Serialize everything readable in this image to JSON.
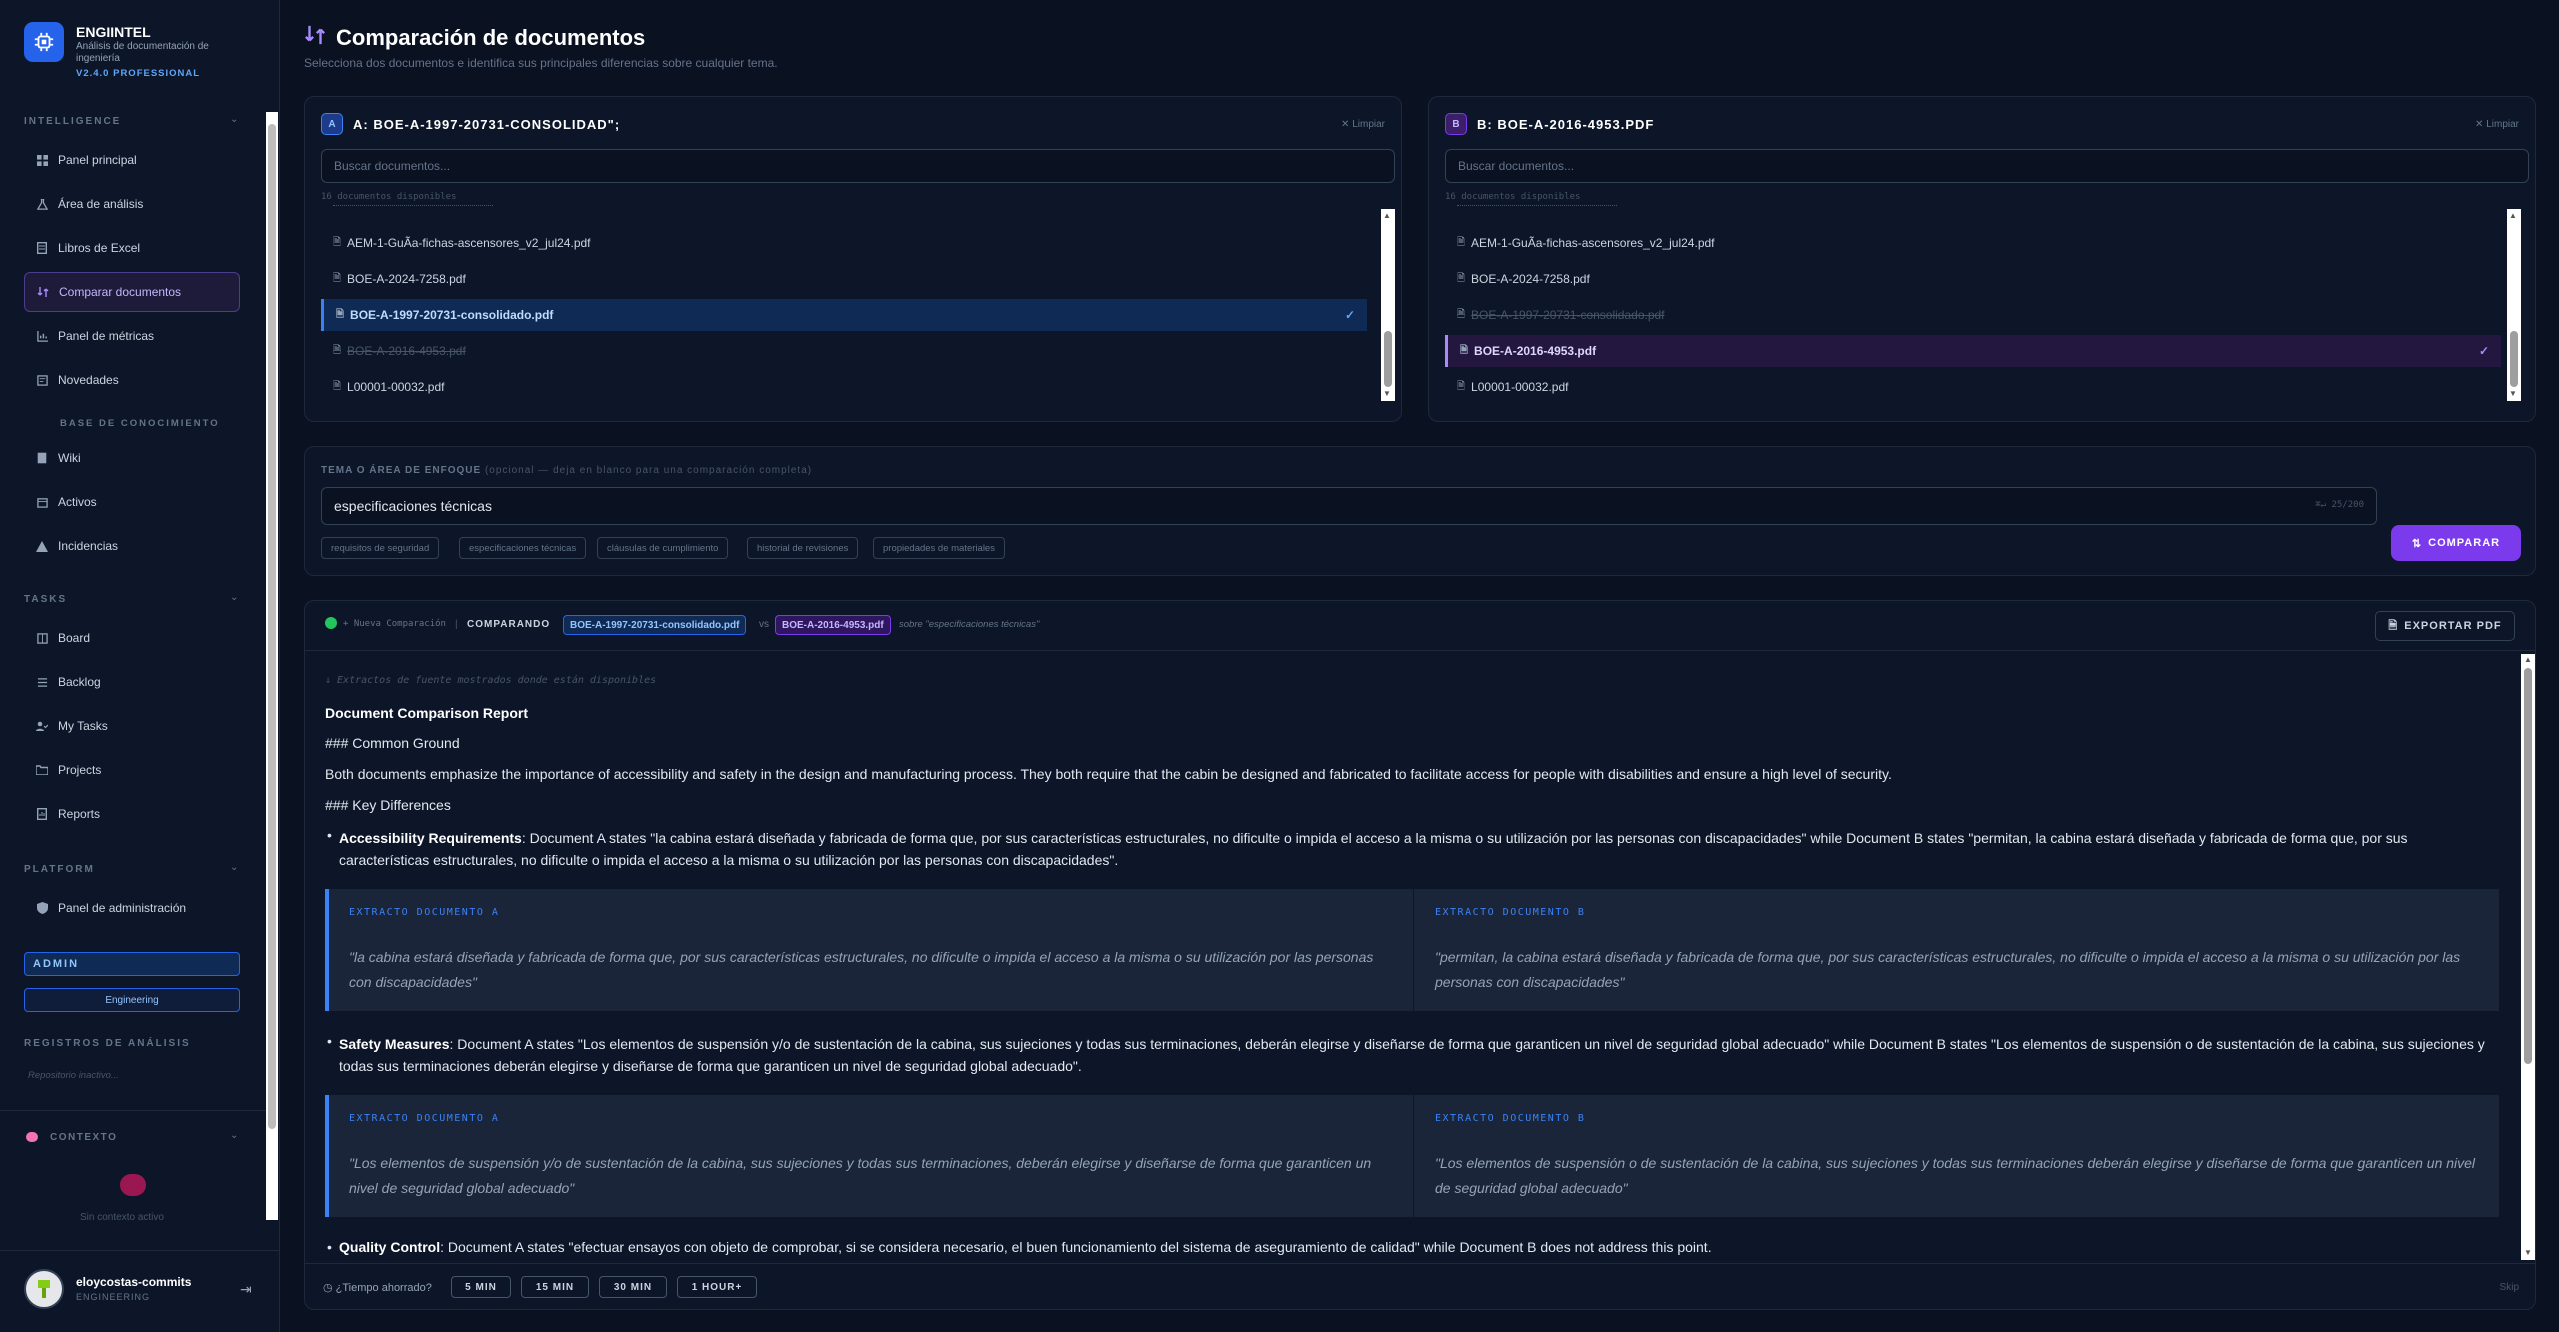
{
  "app": {
    "name": "ENGIINTEL",
    "subtitle": "Análisis de documentación de ingeniería",
    "version": "V2.4.0 PROFESSIONAL"
  },
  "sidebar": {
    "sections": {
      "intelligence": "INTELLIGENCE",
      "knowledge": "BASE DE CONOCIMIENTO",
      "tasks": "TASKS",
      "platform": "PLATFORM",
      "logs": "REGISTROS DE ANÁLISIS",
      "context": "CONTEXTO"
    },
    "intelligence_items": [
      "Panel principal",
      "Área de análisis",
      "Libros de Excel",
      "Comparar documentos",
      "Panel de métricas",
      "Novedades"
    ],
    "knowledge_items": [
      "Wiki",
      "Activos",
      "Incidencias"
    ],
    "task_items": [
      "Board",
      "Backlog",
      "My Tasks",
      "Projects",
      "Reports"
    ],
    "platform_items": [
      "Panel de administración"
    ],
    "role_badge": "ADMIN",
    "team_badge": "Engineering",
    "logs_empty": "Repositorio inactivo...",
    "context_empty": "Sin contexto activo",
    "user": {
      "name": "eloycostas-commits",
      "role": "ENGINEERING"
    }
  },
  "page": {
    "title": "Comparación de documentos",
    "subtitle": "Selecciona dos documentos e identifica sus principales diferencias sobre cualquier tema."
  },
  "docA": {
    "letter": "A",
    "title": "A: BOE-A-1997-20731-CONSOLIDAD\";",
    "clear": "Limpiar",
    "placeholder": "Buscar documentos...",
    "available": "16 documentos disponibles",
    "items": [
      "AEM-1-GuÃ­a-fichas-ascensores_v2_jul24.pdf",
      "BOE-A-2024-7258.pdf",
      "BOE-A-1997-20731-consolidado.pdf",
      "BOE-A-2016-4953.pdf",
      "L00001-00032.pdf"
    ],
    "check": "✓"
  },
  "docB": {
    "letter": "B",
    "title": "B: BOE-A-2016-4953.PDF",
    "clear": "Limpiar",
    "placeholder": "Buscar documentos...",
    "available": "16 documentos disponibles",
    "items": [
      "AEM-1-GuÃ­a-fichas-ascensores_v2_jul24.pdf",
      "BOE-A-2024-7258.pdf",
      "BOE-A-1997-20731-consolidado.pdf",
      "BOE-A-2016-4953.pdf",
      "L00001-00032.pdf"
    ],
    "check": "✓"
  },
  "topic": {
    "label": "TEMA O ÁREA DE ENFOQUE",
    "optional": "(opcional — deja en blanco para una comparación completa)",
    "value": "especificaciones técnicas",
    "counter": "⌘↵ 25/200",
    "chips": [
      "requisitos de seguridad",
      "especificaciones técnicas",
      "cláusulas de cumplimiento",
      "historial de revisiones",
      "propiedades de materiales"
    ],
    "compare": "COMPARAR"
  },
  "results": {
    "new": "+ Nueva Comparación",
    "sep": "|",
    "comparing": "COMPARANDO",
    "docA": "BOE-A-1997-20731-consolidado.pdf",
    "vs": "vs",
    "docB": "BOE-A-2016-4953.pdf",
    "about": "sobre \"especificaciones técnicas\"",
    "export": "EXPORTAR PDF",
    "note": "↓ Extractos de fuente mostrados donde están disponibles",
    "report_title": "Document Comparison Report",
    "h_common": "### Common Ground",
    "common_text": "Both documents emphasize the importance of accessibility and safety in the design and manufacturing process. They both require that the cabin be designed and fabricated to facilitate access for people with disabilities and ensure a high level of security.",
    "h_diff": "### Key Differences",
    "b1_title": "Accessibility Requirements",
    "b1_line1": ": Document A states \"la cabina estará diseñada y fabricada de forma que, por sus características estructurales, no dificulte o impida el acceso a la misma o su utilización por las personas con discapacidades\" while Document B states \"permitan, la cabina estará diseñada y fabricada de forma que, por sus",
    "b1_line2": "características estructurales, no dificulte o impida el acceso a la misma o su utilización por las personas con discapacidades\".",
    "ex_label_a": "EXTRACTO DOCUMENTO A",
    "ex_label_b": "EXTRACTO DOCUMENTO B",
    "ex1_a1": "\"la cabina estará diseñada y fabricada de forma que, por sus características estructurales, no dificulte o impida el acceso a la misma o su utilización por las personas",
    "ex1_a2": "con discapacidades\"",
    "ex1_b1": "\"permitan, la cabina estará diseñada y fabricada de forma que, por sus características estructurales, no dificulte o impida el acceso a la misma o su utilización por las",
    "ex1_b2": "personas con discapacidades\"",
    "b2_title": "Safety Measures",
    "b2_line1": ": Document A states \"Los elementos de suspensión y/o de sustentación de la cabina, sus sujeciones y todas sus terminaciones, deberán elegirse y diseñarse de forma que garanticen un nivel de seguridad global adecuado\" while Document B states \"Los elementos de suspensión o de sustentación de la cabina, sus sujeciones y",
    "b2_line2": "todas sus terminaciones deberán elegirse y diseñarse de forma que garanticen un nivel de seguridad global adecuado\".",
    "ex2_a1": "\"Los elementos de suspensión y/o de sustentación de la cabina, sus sujeciones y todas sus terminaciones, deberán elegirse y diseñarse de forma que garanticen un",
    "ex2_a2": "nivel de seguridad global adecuado\"",
    "ex2_b1": "\"Los elementos de suspensión o de sustentación de la cabina, sus sujeciones y todas sus terminaciones deberán elegirse y diseñarse de forma que garanticen un nivel",
    "ex2_b2": "de seguridad global adecuado\"",
    "b3_title": "Quality Control",
    "b3_line1": ": Document A states \"efectuar ensayos con objeto de comprobar, si se considera necesario, el buen funcionamiento del sistema de aseguramiento de calidad\" while Document B does not address this point.",
    "time_q": "¿Tiempo ahorrado?",
    "times": [
      "5 MIN",
      "15 MIN",
      "30 MIN",
      "1 HOUR+"
    ],
    "skip": "Skip"
  }
}
